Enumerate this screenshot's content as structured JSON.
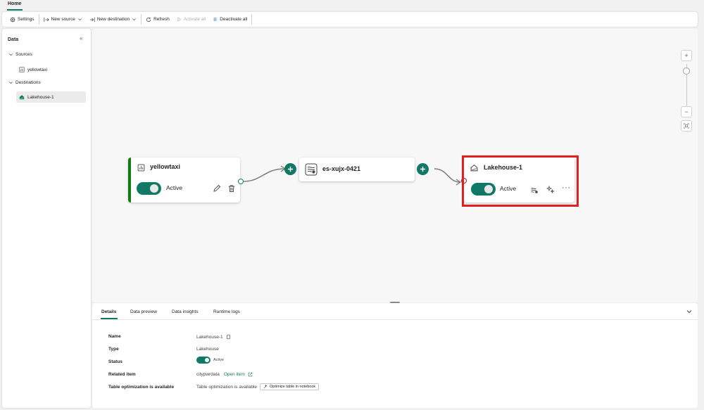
{
  "tabs": {
    "home": "Home"
  },
  "ribbon": {
    "settings": "Settings",
    "new_source": "New source",
    "new_destination": "New destination",
    "refresh": "Refresh",
    "activate_all": "Activate all",
    "deactivate_all": "Deactivate all"
  },
  "left_panel": {
    "title": "Data",
    "sources_label": "Sources",
    "sources": [
      "yellowtaxi"
    ],
    "destinations_label": "Destinations",
    "destinations": [
      "Lakehouse-1"
    ]
  },
  "canvas": {
    "source_node": {
      "title": "yellowtaxi",
      "status": "Active"
    },
    "stream_node": {
      "title": "es-xujx-0421"
    },
    "destination_node": {
      "title": "Lakehouse-1",
      "status": "Active"
    }
  },
  "bottom_panel": {
    "tabs": [
      "Details",
      "Data preview",
      "Data insights",
      "Runtime logs"
    ],
    "details": {
      "name_label": "Name",
      "name_value": "Lakehouse-1",
      "type_label": "Type",
      "type_value": "Lakehouse",
      "status_label": "Status",
      "status_value": "Active",
      "related_label": "Related item",
      "related_value": "citypwrdata",
      "open_item": "Open item",
      "table_opt_label": "Table optimization is available",
      "table_opt_value": "Table optimization is available",
      "optimize_button": "Optimize table in notebook"
    }
  },
  "colors": {
    "accent": "#117865",
    "highlight": "#e02020",
    "source_bar": "#107c10"
  }
}
